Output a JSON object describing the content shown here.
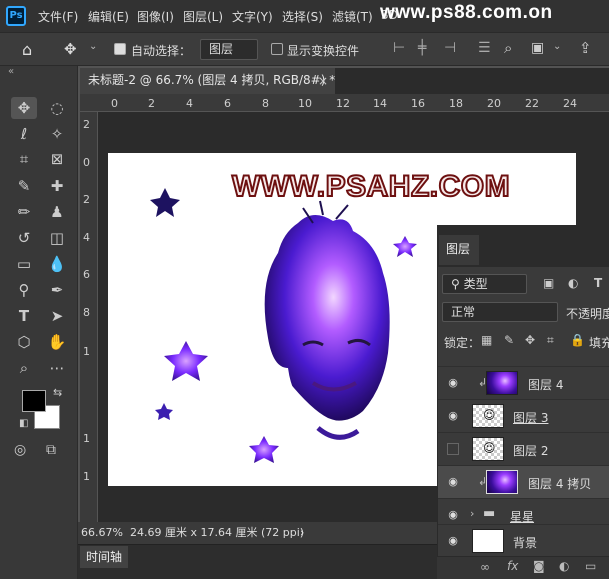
{
  "app": {
    "logo": "Ps",
    "watermark": "www.ps88.com.on"
  },
  "menu": [
    "文件(F)",
    "编辑(E)",
    "图像(I)",
    "图层(L)",
    "文字(Y)",
    "选择(S)",
    "滤镜(T)",
    "3D"
  ],
  "options": {
    "auto_select_label": "自动选择：",
    "auto_select_value": "图层",
    "show_transform_label": "显示变换控件"
  },
  "document": {
    "tab_title": "未标题-2 @ 66.7% (图层 4 拷贝, RGB/8#) *",
    "close": "×",
    "canvas_text": "WWW.PSAHZ.COM"
  },
  "ruler": {
    "top": [
      "0",
      "2",
      "4",
      "6",
      "8",
      "10",
      "12",
      "14",
      "16",
      "18",
      "20",
      "22",
      "24"
    ],
    "left": [
      "2",
      "0",
      "2",
      "4",
      "6",
      "8",
      "1",
      "1",
      "1"
    ]
  },
  "status": {
    "zoom": "66.67%",
    "size": "24.69 厘米 x 17.64 厘米 (72 ppi)",
    "arrow": "›"
  },
  "timeline": {
    "label": "时间轴"
  },
  "layers_panel": {
    "title": "图层",
    "filter_label": "类型",
    "blend_mode": "正常",
    "opacity_label": "不透明度",
    "lock_label": "锁定：",
    "fill_label": "填充",
    "layers": [
      {
        "name": "图层 4",
        "visible": true,
        "selected": false,
        "thumb": "galaxy",
        "clipped": true
      },
      {
        "name": "图层 3",
        "visible": true,
        "selected": false,
        "thumb": "face",
        "clipped": false
      },
      {
        "name": "图层 2",
        "visible": false,
        "selected": false,
        "thumb": "face",
        "clipped": false
      },
      {
        "name": "图层 4 拷贝",
        "visible": true,
        "selected": true,
        "thumb": "galaxy",
        "clipped": true
      },
      {
        "name": "星星",
        "visible": true,
        "selected": false,
        "thumb": "folder",
        "clipped": false
      },
      {
        "name": "背景",
        "visible": true,
        "selected": false,
        "thumb": "white",
        "clipped": false
      }
    ]
  },
  "colors": {
    "ps_blue": "#31a8ff",
    "galaxy_purple": "#7a2cff",
    "text_red": "#6d1010"
  }
}
